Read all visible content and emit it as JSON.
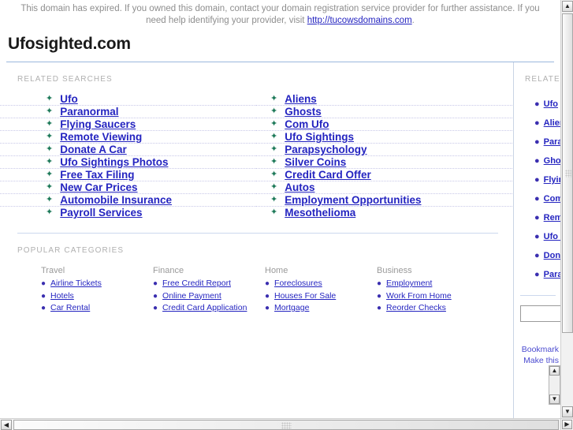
{
  "banner": {
    "text_before": "This domain has expired. If you owned this domain, contact your domain registration service provider for further assistance. If you need help identifying your provider, visit ",
    "link_text": "http://tucowsdomains.com",
    "text_after": "."
  },
  "domain": {
    "title": "Ufosighted.com"
  },
  "related": {
    "label": "RELATED SEARCHES",
    "rows": [
      {
        "left": "Ufo",
        "right": "Aliens"
      },
      {
        "left": "Paranormal",
        "right": "Ghosts"
      },
      {
        "left": "Flying Saucers",
        "right": "Com Ufo"
      },
      {
        "left": "Remote Viewing",
        "right": "Ufo Sightings"
      },
      {
        "left": "Donate A Car",
        "right": "Parapsychology"
      },
      {
        "left": "Ufo Sightings Photos",
        "right": "Silver Coins"
      },
      {
        "left": "Free Tax Filing",
        "right": "Credit Card Offer"
      },
      {
        "left": "New Car Prices",
        "right": "Autos"
      },
      {
        "left": "Automobile Insurance",
        "right": "Employment Opportunities"
      },
      {
        "left": "Payroll Services",
        "right": "Mesothelioma"
      }
    ]
  },
  "categories": {
    "label": "POPULAR CATEGORIES",
    "columns": [
      {
        "title": "Travel",
        "items": [
          "Airline Tickets",
          "Hotels",
          "Car Rental"
        ]
      },
      {
        "title": "Finance",
        "items": [
          "Free Credit Report",
          "Online Payment",
          "Credit Card Application"
        ]
      },
      {
        "title": "Home",
        "items": [
          "Foreclosures",
          "Houses For Sale",
          "Mortgage"
        ]
      },
      {
        "title": "Business",
        "items": [
          "Employment",
          "Work From Home",
          "Reorder Checks"
        ]
      }
    ]
  },
  "right_panel": {
    "label": "RELATED",
    "items": [
      "Ufo",
      "Aliens",
      "Paranormal",
      "Ghosts",
      "Flying Saucers",
      "Com Ufo",
      "Remote Viewing",
      "Ufo Sightings",
      "Donate A Car",
      "Parapsychology"
    ],
    "search_value": "",
    "search_placeholder": "",
    "footer_links": [
      "Bookmark",
      "Make this"
    ]
  },
  "icons": {
    "star": "✦",
    "dot": "●",
    "arrow_up": "▲",
    "arrow_down": "▼",
    "arrow_left": "◀",
    "arrow_right": "▶"
  },
  "colors": {
    "link": "#2424c0",
    "star": "#1f7a5a",
    "bullet": "#3b2fb0",
    "muted": "#b0b0b0",
    "rule": "#9bb7dd"
  }
}
